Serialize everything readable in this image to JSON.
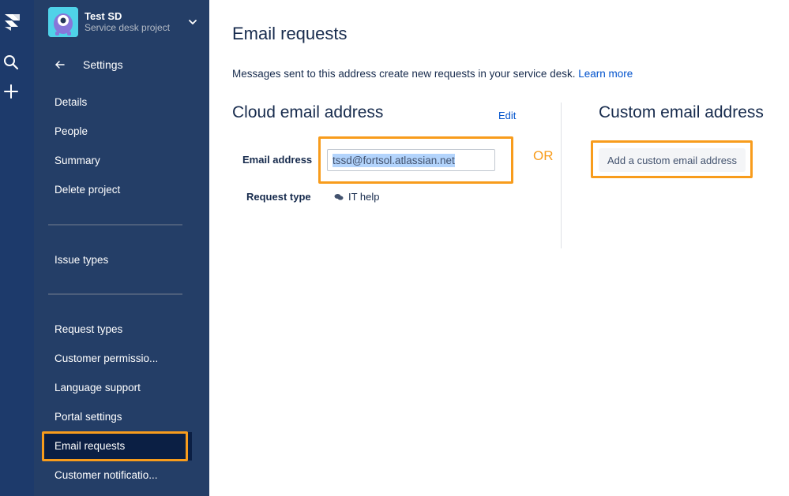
{
  "project": {
    "name": "Test SD",
    "type": "Service desk project"
  },
  "sidebar": {
    "back_label": "Settings",
    "group1": [
      "Details",
      "People",
      "Summary",
      "Delete project"
    ],
    "group2": [
      "Issue types"
    ],
    "group3": [
      "Request types",
      "Customer permissio...",
      "Language support",
      "Portal settings",
      "Email requests",
      "Customer notificatio..."
    ],
    "active_item": "Email requests"
  },
  "main": {
    "title": "Email requests",
    "intro_text": "Messages sent to this address create new requests in your service desk.",
    "learn_more": "Learn more",
    "cloud": {
      "title": "Cloud email address",
      "edit_label": "Edit",
      "email_label": "Email address",
      "email_value": "tssd@fortsol.atlassian.net",
      "request_type_label": "Request type",
      "request_type_value": "IT help"
    },
    "or_label": "OR",
    "custom": {
      "title": "Custom email address",
      "button_label": "Add a custom email address"
    }
  },
  "colors": {
    "rail": "#1d3a6b",
    "sidebar": "#243e67",
    "active_item": "#0b1f44",
    "highlight": "#f89c1c",
    "link": "#0052cc",
    "text": "#172b4d"
  },
  "icons": {
    "logo": "jira-service-desk-logo-icon",
    "search": "search-icon",
    "create": "plus-icon",
    "avatar": "project-avatar-icon",
    "chevron": "chevron-down-icon",
    "back": "arrow-left-icon",
    "request_type": "speech-bubbles-icon"
  }
}
